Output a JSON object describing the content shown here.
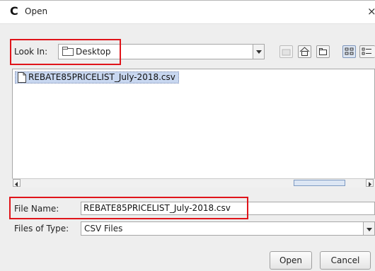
{
  "window": {
    "app_icon": "C",
    "title": "Open",
    "close": "×"
  },
  "look_in": {
    "label": "Look In:",
    "value": "Desktop"
  },
  "toolbar": {
    "icons": [
      "up-folder-icon",
      "home-icon",
      "new-folder-icon",
      "list-view-icon",
      "details-view-icon"
    ]
  },
  "files": [
    "REBATE85PRICELIST_July-2018.csv"
  ],
  "file_name": {
    "label": "File Name:",
    "value": "REBATE85PRICELIST_July-2018.csv"
  },
  "file_type": {
    "label": "Files of Type:",
    "value": "CSV Files"
  },
  "buttons": {
    "open": "Open",
    "cancel": "Cancel"
  },
  "colors": {
    "highlight_box": "#e0141a",
    "selection": "#c8d7f0"
  }
}
